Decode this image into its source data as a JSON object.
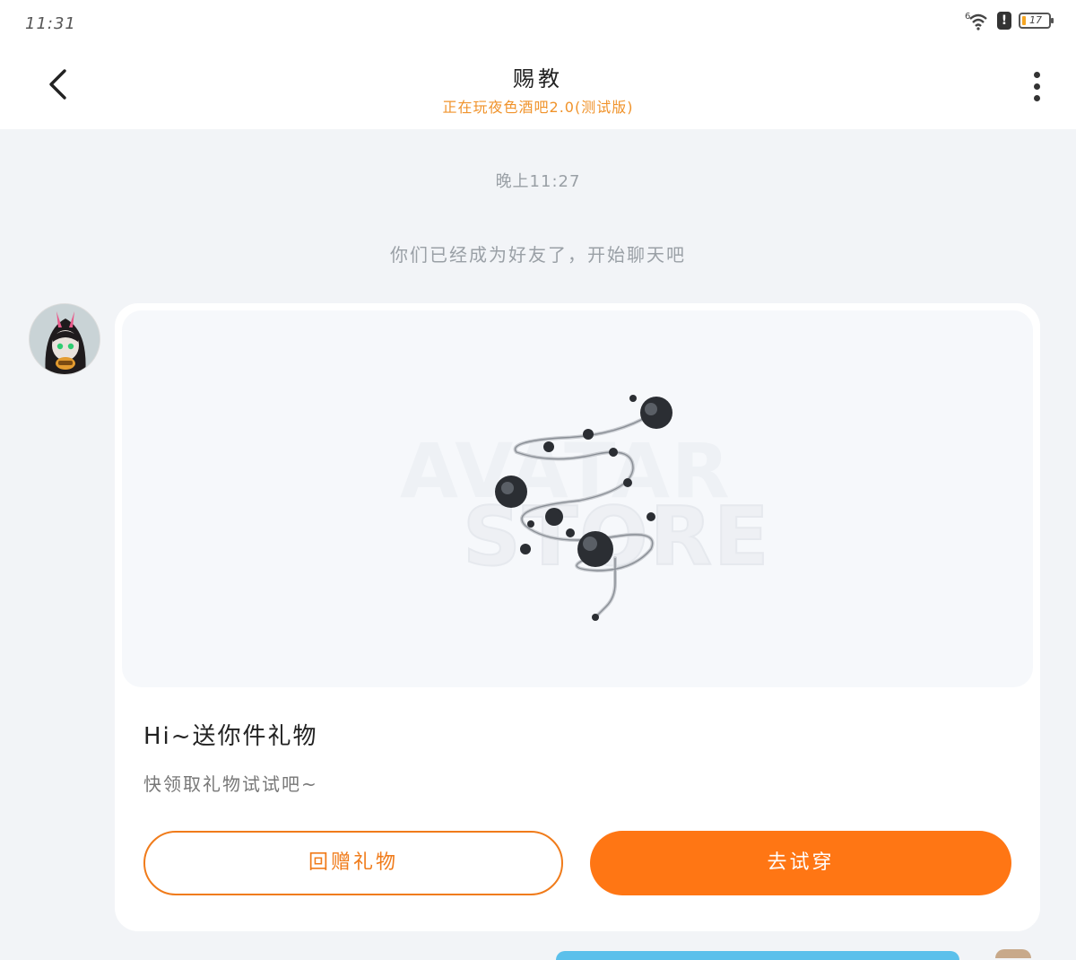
{
  "status_bar": {
    "time": "11:31",
    "signal_label": "6",
    "battery_level": "17",
    "icons": [
      "wifi-icon",
      "alert-icon",
      "battery-icon"
    ]
  },
  "header": {
    "title": "赐教",
    "subtitle": "正在玩夜色酒吧2.0(测试版)",
    "back_icon": "chevron-left-icon",
    "more_icon": "more-vertical-icon",
    "subtitle_color": "#f0932b"
  },
  "chat": {
    "timestamp": "晚上11:27",
    "system_note": "你们已经成为好友了，开始聊天吧",
    "gift_message": {
      "image_watermark_line1": "AVATAR",
      "image_watermark_line2": "STORE",
      "title": "Hi~送你件礼物",
      "description": "快领取礼物试试吧~",
      "return_gift_label": "回赠礼物",
      "try_on_label": "去试穿",
      "accent_color": "#ff7614"
    }
  }
}
